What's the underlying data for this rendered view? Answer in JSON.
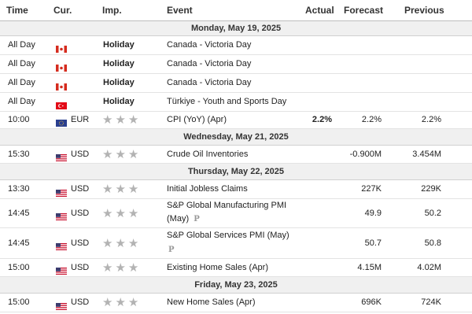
{
  "headers": {
    "time": "Time",
    "currency": "Cur.",
    "importance": "Imp.",
    "event": "Event",
    "actual": "Actual",
    "forecast": "Forecast",
    "previous": "Previous"
  },
  "dates": [
    "Monday, May 19, 2025",
    "Wednesday, May 21, 2025",
    "Thursday, May 22, 2025",
    "Friday, May 23, 2025"
  ],
  "rows": [
    {
      "time": "All Day",
      "flag": "CA",
      "currency": "",
      "importance": "Holiday",
      "event": "Canada - Victoria Day",
      "actual": "",
      "forecast": "",
      "previous": ""
    },
    {
      "time": "All Day",
      "flag": "CA",
      "currency": "",
      "importance": "Holiday",
      "event": "Canada - Victoria Day",
      "actual": "",
      "forecast": "",
      "previous": ""
    },
    {
      "time": "All Day",
      "flag": "CA",
      "currency": "",
      "importance": "Holiday",
      "event": "Canada - Victoria Day",
      "actual": "",
      "forecast": "",
      "previous": ""
    },
    {
      "time": "All Day",
      "flag": "TR",
      "currency": "",
      "importance": "Holiday",
      "event": "Türkiye - Youth and Sports Day",
      "actual": "",
      "forecast": "",
      "previous": ""
    },
    {
      "time": "10:00",
      "flag": "EU",
      "currency": "EUR",
      "importance_stars": 3,
      "event": "CPI (YoY) (Apr)",
      "actual": "2.2%",
      "forecast": "2.2%",
      "previous": "2.2%"
    },
    {
      "time": "15:30",
      "flag": "US",
      "currency": "USD",
      "importance_stars": 3,
      "event": "Crude Oil Inventories",
      "actual": "",
      "forecast": "-0.900M",
      "previous": "3.454M"
    },
    {
      "time": "13:30",
      "flag": "US",
      "currency": "USD",
      "importance_stars": 3,
      "event": "Initial Jobless Claims",
      "actual": "",
      "forecast": "227K",
      "previous": "229K"
    },
    {
      "time": "14:45",
      "flag": "US",
      "currency": "USD",
      "importance_stars": 3,
      "event_line1": "S&P Global Manufacturing PMI",
      "event_line2": "(May)",
      "preliminary_mark": "P",
      "actual": "",
      "forecast": "49.9",
      "previous": "50.2"
    },
    {
      "time": "14:45",
      "flag": "US",
      "currency": "USD",
      "importance_stars": 3,
      "event_line1": "S&P Global Services PMI (May)",
      "preliminary_mark": "P",
      "actual": "",
      "forecast": "50.7",
      "previous": "50.8"
    },
    {
      "time": "15:00",
      "flag": "US",
      "currency": "USD",
      "importance_stars": 3,
      "event": "Existing Home Sales (Apr)",
      "actual": "",
      "forecast": "4.15M",
      "previous": "4.02M"
    },
    {
      "time": "15:00",
      "flag": "US",
      "currency": "USD",
      "importance_stars": 3,
      "event": "New Home Sales (Apr)",
      "actual": "",
      "forecast": "696K",
      "previous": "724K"
    }
  ],
  "stars_glyph": "★★★",
  "colors": {
    "star": "#b3b3b3",
    "date_bg": "#f0f0f0"
  }
}
